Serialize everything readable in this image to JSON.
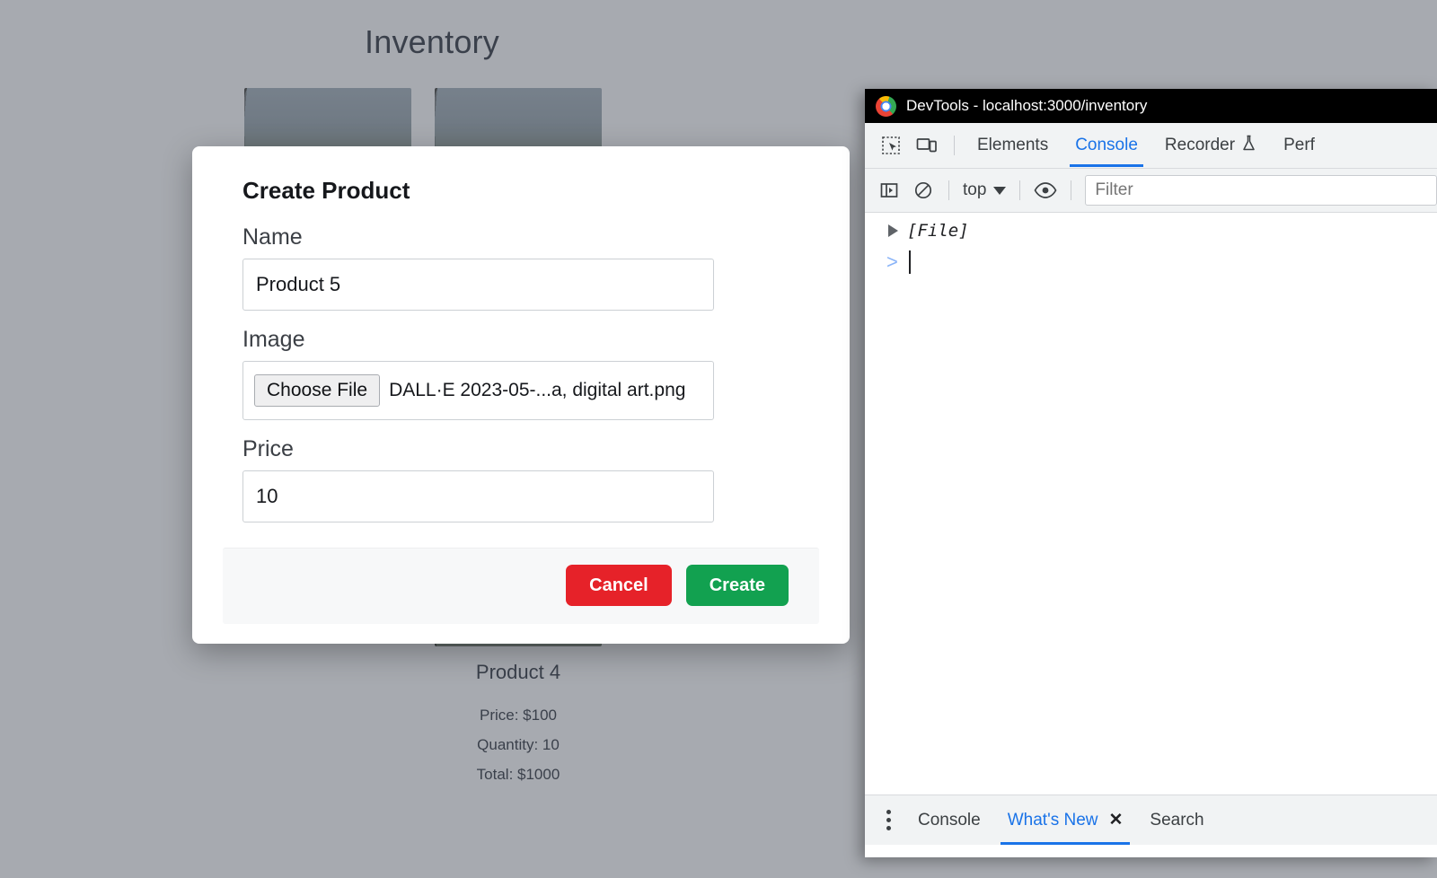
{
  "page": {
    "title": "Inventory",
    "products": [
      {
        "name": "",
        "price": "",
        "quantity": "",
        "total": ""
      },
      {
        "name": "",
        "price": "",
        "quantity": "",
        "total": ""
      },
      {
        "name": "",
        "price": "",
        "quantity": "",
        "total": ""
      },
      {
        "name": "Product 4",
        "price": "Price: $100",
        "quantity": "Quantity: 10",
        "total": "Total: $1000"
      }
    ]
  },
  "modal": {
    "title": "Create Product",
    "name_label": "Name",
    "name_value": "Product 5",
    "name_placeholder": "",
    "image_label": "Image",
    "choose_file_label": "Choose File",
    "file_name": "DALL·E 2023-05-...a, digital art.png",
    "price_label": "Price",
    "price_value": "10",
    "price_placeholder": "",
    "cancel_label": "Cancel",
    "create_label": "Create",
    "cancel_color": "#e62229",
    "create_color": "#12a150"
  },
  "devtools": {
    "window_title": "DevTools - localhost:3000/inventory",
    "logo_icon": "chrome-logo-icon",
    "toolbar_icons": [
      {
        "name": "inspect-element-icon"
      },
      {
        "name": "device-toolbar-icon"
      }
    ],
    "tabs": [
      {
        "label": "Elements",
        "active": false
      },
      {
        "label": "Console",
        "active": true
      },
      {
        "label": "Recorder",
        "active": false,
        "badge_icon": "flask-icon"
      },
      {
        "label": "Perf",
        "active": false
      }
    ],
    "filterbar": {
      "sidebar_icon": "console-sidebar-icon",
      "clear_icon": "clear-console-icon",
      "context": "top",
      "eye_icon": "live-expression-icon",
      "filter_placeholder": "Filter",
      "filter_value": ""
    },
    "console": {
      "entries": [
        {
          "expand_icon": "disclosure-triangle-icon",
          "text": "[File]"
        }
      ],
      "prompt_symbol": ">"
    },
    "drawer": {
      "menu_icon": "more-options-icon",
      "tabs": [
        {
          "label": "Console",
          "active": false,
          "closable": false
        },
        {
          "label": "What's New",
          "active": true,
          "closable": true,
          "close_icon": "close-icon"
        },
        {
          "label": "Search",
          "active": false,
          "closable": false
        }
      ]
    },
    "accent_color": "#1a73e8"
  }
}
